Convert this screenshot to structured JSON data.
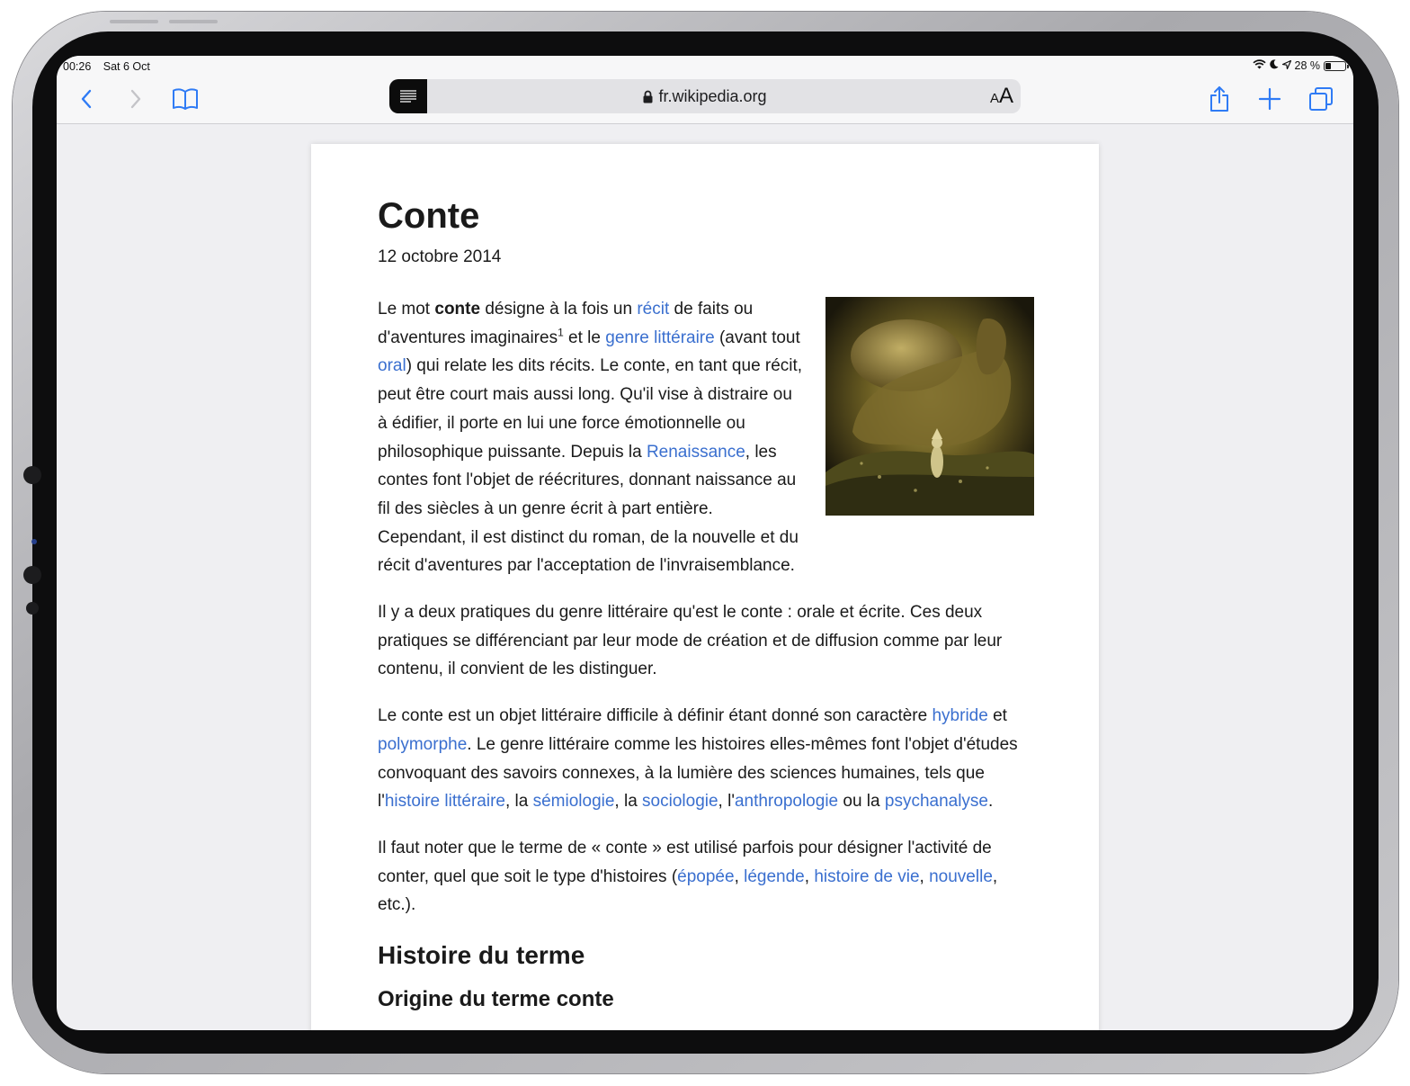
{
  "status": {
    "time": "00:26",
    "date": "Sat 6 Oct",
    "battery_text": "28 %",
    "battery_level": 0.28
  },
  "browser": {
    "url": "fr.wikipedia.org",
    "text_size_label_small": "A",
    "text_size_label_large": "A"
  },
  "article": {
    "title": "Conte",
    "date": "12 octobre 2014",
    "p1": {
      "t1": "Le mot ",
      "bold": "conte",
      "t2": " désigne à la fois un ",
      "l1": "récit",
      "t3": " de faits ou d'aventures imaginaires",
      "sup": "1",
      "t4": " et le ",
      "l2": "genre littéraire",
      "t5": " (avant tout ",
      "l3": "oral",
      "t6": ") qui relate les dits récits. Le conte, en tant que récit, peut être court mais aussi long. Qu'il vise à distraire ou à édifier, il porte en lui une force émotionnelle ou philosophique puissante. Depuis la ",
      "l4": "Renaissance",
      "t7": ", les contes font l'objet de réécritures, donnant naissance au fil des siècles à un genre écrit à part entière. Cependant, il est distinct du roman, de la nouvelle et du récit d'aventures par l'acceptation de l'invraisemblance."
    },
    "p2": "Il y a deux pratiques du genre littéraire qu'est le conte : orale et écrite. Ces deux pratiques se différenciant par leur mode de création et de diffusion comme par leur contenu, il convient de les distinguer.",
    "p3": {
      "t1": "Le conte est un objet littéraire difficile à définir étant donné son caractère ",
      "l1": "hybride",
      "t2": " et ",
      "l2": "polymorphe",
      "t3": ". Le genre littéraire comme les histoires elles-mêmes font l'objet d'études convoquant des savoirs connexes, à la lumière des sciences humaines, tels que l'",
      "l3": "histoire littéraire",
      "t4": ", la ",
      "l4": "sémiologie",
      "t5": ", la ",
      "l5": "sociologie",
      "t6": ", l'",
      "l6": "anthropologie",
      "t7": " ou la ",
      "l7": "psychanalyse",
      "t8": "."
    },
    "p4": {
      "t1": "Il faut noter que le terme de « conte » est utilisé parfois pour désigner l'activité de conter, quel que soit le type d'histoires (",
      "l1": "épopée",
      "s1": ", ",
      "l2": "légende",
      "s2": ", ",
      "l3": "histoire de vie",
      "s3": ", ",
      "l4": "nouvelle",
      "t2": ", etc.)."
    },
    "h2": "Histoire du terme",
    "h3": "Origine du terme conte"
  },
  "colors": {
    "link": "#3a6fcf",
    "accent": "#2f7bf5"
  }
}
